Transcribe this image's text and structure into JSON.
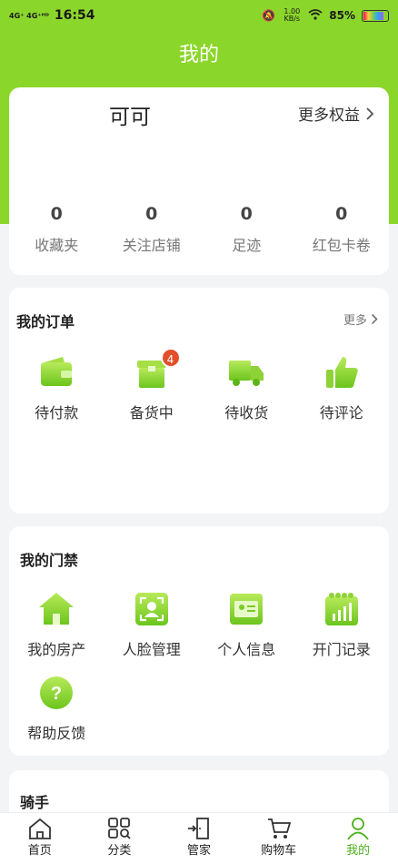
{
  "status": {
    "net": "4G⁺ 4G⁺ᴴᴰ",
    "time": "16:54",
    "speed": "1.00 KB/s",
    "battery": "85%",
    "battery_level": 0.85
  },
  "page": {
    "title": "我的"
  },
  "profile": {
    "name": "可可",
    "more_rights": "更多权益",
    "stats": [
      {
        "value": "0",
        "label": "收藏夹"
      },
      {
        "value": "0",
        "label": "关注店铺"
      },
      {
        "value": "0",
        "label": "足迹"
      },
      {
        "value": "0",
        "label": "红包卡卷"
      }
    ]
  },
  "orders": {
    "title": "我的订单",
    "more": "更多",
    "items": [
      {
        "label": "待付款",
        "icon": "wallet-icon"
      },
      {
        "label": "备货中",
        "icon": "box-icon",
        "badge": "4"
      },
      {
        "label": "待收货",
        "icon": "truck-icon"
      },
      {
        "label": "待评论",
        "icon": "thumbs-up-icon"
      }
    ]
  },
  "access": {
    "title": "我的门禁",
    "items": [
      {
        "label": "我的房产",
        "icon": "house-icon"
      },
      {
        "label": "人脸管理",
        "icon": "face-scan-icon"
      },
      {
        "label": "个人信息",
        "icon": "id-card-icon"
      },
      {
        "label": "开门记录",
        "icon": "records-icon"
      },
      {
        "label": "帮助反馈",
        "icon": "help-icon"
      }
    ]
  },
  "rider": {
    "title": "骑手"
  },
  "tabbar": [
    {
      "label": "首页",
      "icon": "home-icon"
    },
    {
      "label": "分类",
      "icon": "category-icon"
    },
    {
      "label": "管家",
      "icon": "door-icon"
    },
    {
      "label": "购物车",
      "icon": "cart-icon"
    },
    {
      "label": "我的",
      "icon": "profile-icon",
      "active": true
    }
  ],
  "colors": {
    "brand": "#8bd62a",
    "badge": "#e24f2a",
    "active_tab": "#4caf1a"
  }
}
